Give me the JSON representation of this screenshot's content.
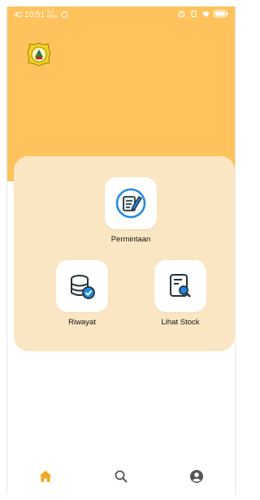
{
  "status_bar": {
    "time": "10:51",
    "network_speed": "0.2",
    "network_unit": "KB/s",
    "signal_label": "4G"
  },
  "header": {
    "logo_icon": "university-crest-icon",
    "background_color": "#ffc25c"
  },
  "menu": {
    "background_color": "#fbe6c3",
    "items": [
      {
        "label": "Permintaan",
        "icon": "edit-document-icon"
      },
      {
        "label": "Riwayat",
        "icon": "database-check-icon"
      },
      {
        "label": "Lihat Stock",
        "icon": "document-search-icon"
      }
    ]
  },
  "bottom_nav": {
    "items": [
      {
        "icon": "home-icon",
        "active": true,
        "color": "#f5a623"
      },
      {
        "icon": "search-icon",
        "active": false,
        "color": "#555555"
      },
      {
        "icon": "account-icon",
        "active": false,
        "color": "#555555"
      }
    ]
  }
}
